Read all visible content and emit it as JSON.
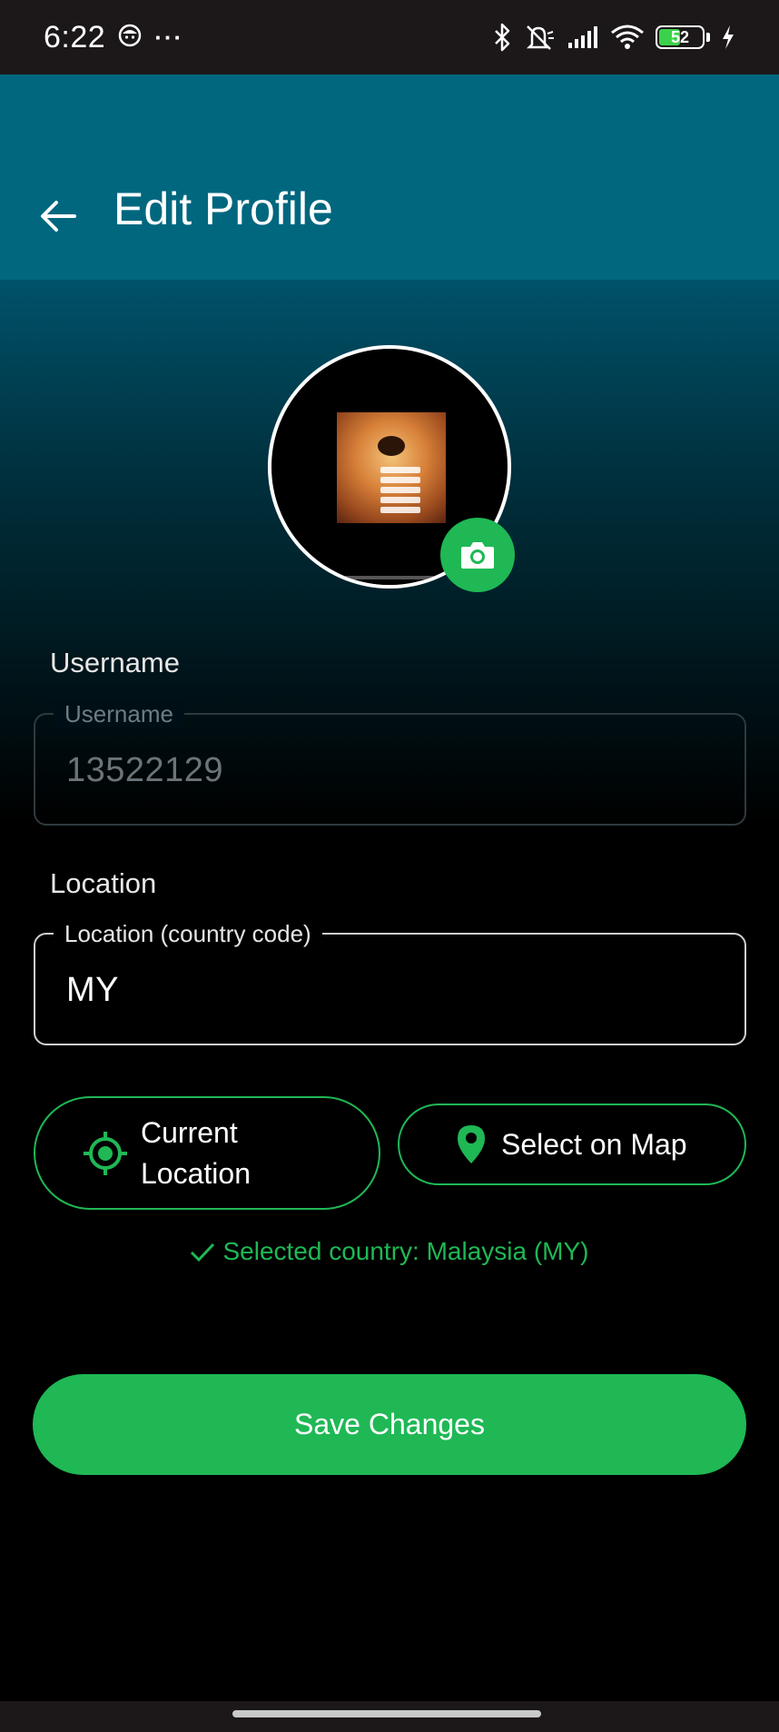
{
  "status_bar": {
    "time": "6:22",
    "more": "···",
    "battery": "52",
    "icons": [
      "app-face-icon",
      "bluetooth-icon",
      "mute-icon",
      "signal-icon",
      "wifi-icon",
      "battery-icon",
      "charging-icon"
    ],
    "battery_level": 0.52
  },
  "header": {
    "title": "Edit Profile",
    "back_icon": "arrow-left-icon"
  },
  "avatar": {
    "camera_icon": "camera-icon"
  },
  "username": {
    "section_label": "Username",
    "field_label": "Username",
    "value": "13522129",
    "disabled": true
  },
  "location": {
    "section_label": "Location",
    "field_label": "Location (country code)",
    "value": "MY",
    "current_location_label": "Current Location",
    "select_on_map_label": "Select on Map",
    "selected_message": "Selected country: Malaysia (MY)"
  },
  "actions": {
    "save_label": "Save Changes"
  },
  "colors": {
    "header": "#00677f",
    "accent": "#1fb855",
    "background": "#000000",
    "status_bar": "#1c1718"
  }
}
